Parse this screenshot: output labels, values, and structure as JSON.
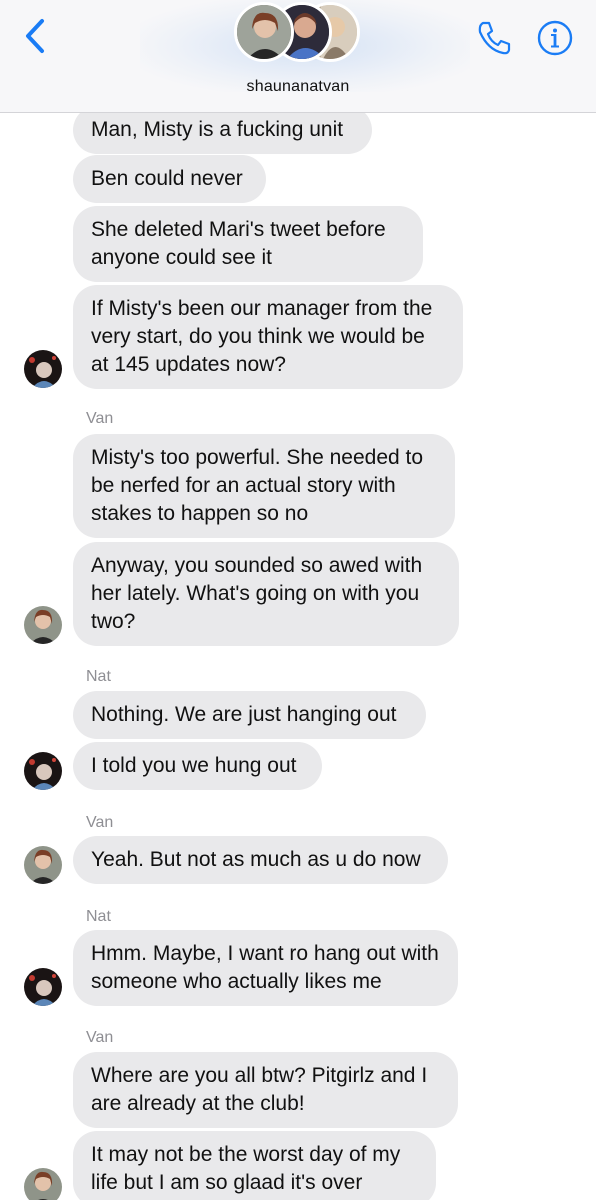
{
  "header": {
    "title": "shaunanatvan",
    "back_icon": "chevron-left-icon",
    "call_icon": "phone-icon",
    "info_icon": "info-icon",
    "accent_color": "#1a7cf5"
  },
  "messages": [
    {
      "text": "Man, Misty is a fucking unit"
    },
    {
      "text": "Ben could never"
    },
    {
      "text": "She deleted Mari's tweet before anyone could see it"
    },
    {
      "text": "If Misty's been our manager from the very start, do you think we would be at 145 updates now?"
    },
    {
      "sender": "Van"
    },
    {
      "text": "Misty's too powerful. She needed to be nerfed for an actual story with stakes to happen so no"
    },
    {
      "text": "Anyway, you sounded so awed with her lately. What's going on with you two?"
    },
    {
      "sender": "Nat"
    },
    {
      "text": "Nothing. We are just hanging out"
    },
    {
      "text": "I told you we hung out"
    },
    {
      "sender": "Van"
    },
    {
      "text": "Yeah. But not as much as u do now"
    },
    {
      "sender": "Nat"
    },
    {
      "text": "Hmm. Maybe, I want ro hang out with someone who actually likes me"
    },
    {
      "sender": "Van"
    },
    {
      "text": "Where are you all btw? Pitgirlz and I are already at the club!"
    },
    {
      "text": "It may not be the worst day of my life but I am so glaad it's over"
    }
  ],
  "colors": {
    "bubble_bg": "#e9e9eb",
    "sender_label": "#8e8e93"
  }
}
